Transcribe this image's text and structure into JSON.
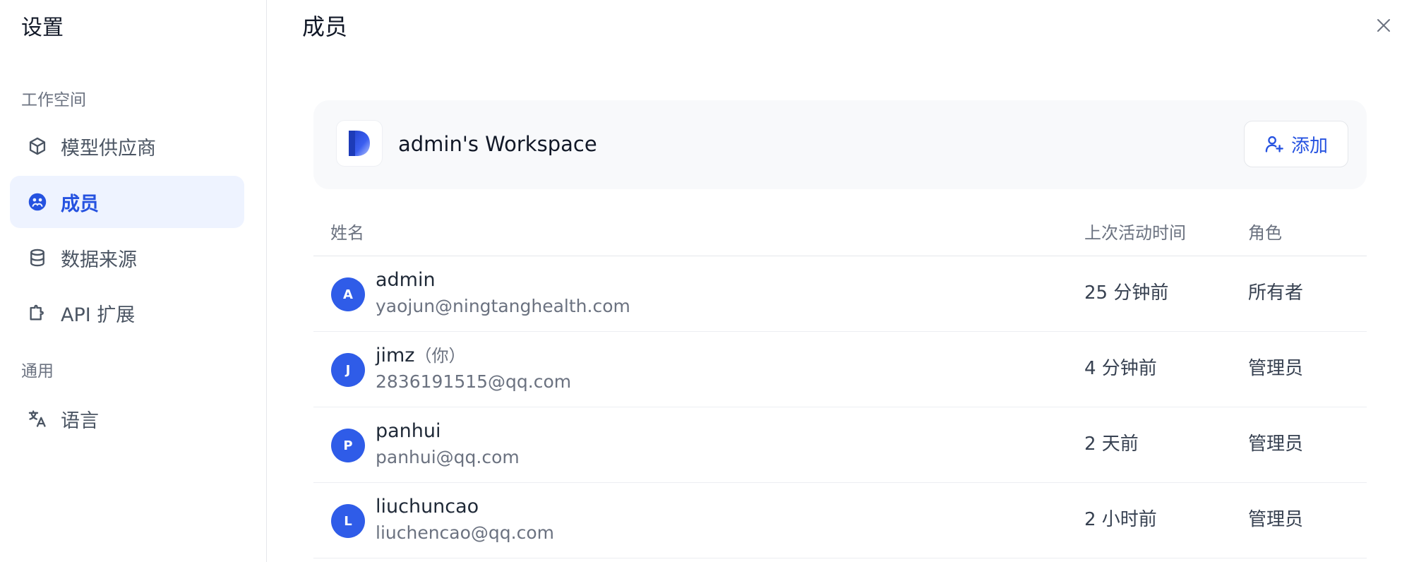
{
  "sidebar": {
    "title": "设置",
    "sections": [
      {
        "label": "工作空间",
        "items": [
          {
            "label": "模型供应商",
            "icon": "cube-icon",
            "active": false
          },
          {
            "label": "成员",
            "icon": "members-icon",
            "active": true
          },
          {
            "label": "数据来源",
            "icon": "database-icon",
            "active": false
          },
          {
            "label": "API 扩展",
            "icon": "puzzle-icon",
            "active": false
          }
        ]
      },
      {
        "label": "通用",
        "items": [
          {
            "label": "语言",
            "icon": "translate-icon",
            "active": false
          }
        ]
      }
    ]
  },
  "main": {
    "title": "成员",
    "workspace": {
      "name": "admin's Workspace",
      "add_label": "添加"
    },
    "table": {
      "headers": {
        "name": "姓名",
        "last_active": "上次活动时间",
        "role": "角色"
      },
      "rows": [
        {
          "avatar": "A",
          "name": "admin",
          "you": "",
          "email": "yaojun@ningtanghealth.com",
          "last_active": "25 分钟前",
          "role": "所有者"
        },
        {
          "avatar": "J",
          "name": "jimz",
          "you": "（你）",
          "email": "2836191515@qq.com",
          "last_active": "4 分钟前",
          "role": "管理员"
        },
        {
          "avatar": "P",
          "name": "panhui",
          "you": "",
          "email": "panhui@qq.com",
          "last_active": "2 天前",
          "role": "管理员"
        },
        {
          "avatar": "L",
          "name": "liuchuncao",
          "you": "",
          "email": "liuchencao@qq.com",
          "last_active": "2 小时前",
          "role": "管理员"
        }
      ]
    }
  },
  "colors": {
    "accent": "#2552e0",
    "avatar_bg": "#2f5ce8",
    "active_nav_bg": "#eef3ff"
  }
}
